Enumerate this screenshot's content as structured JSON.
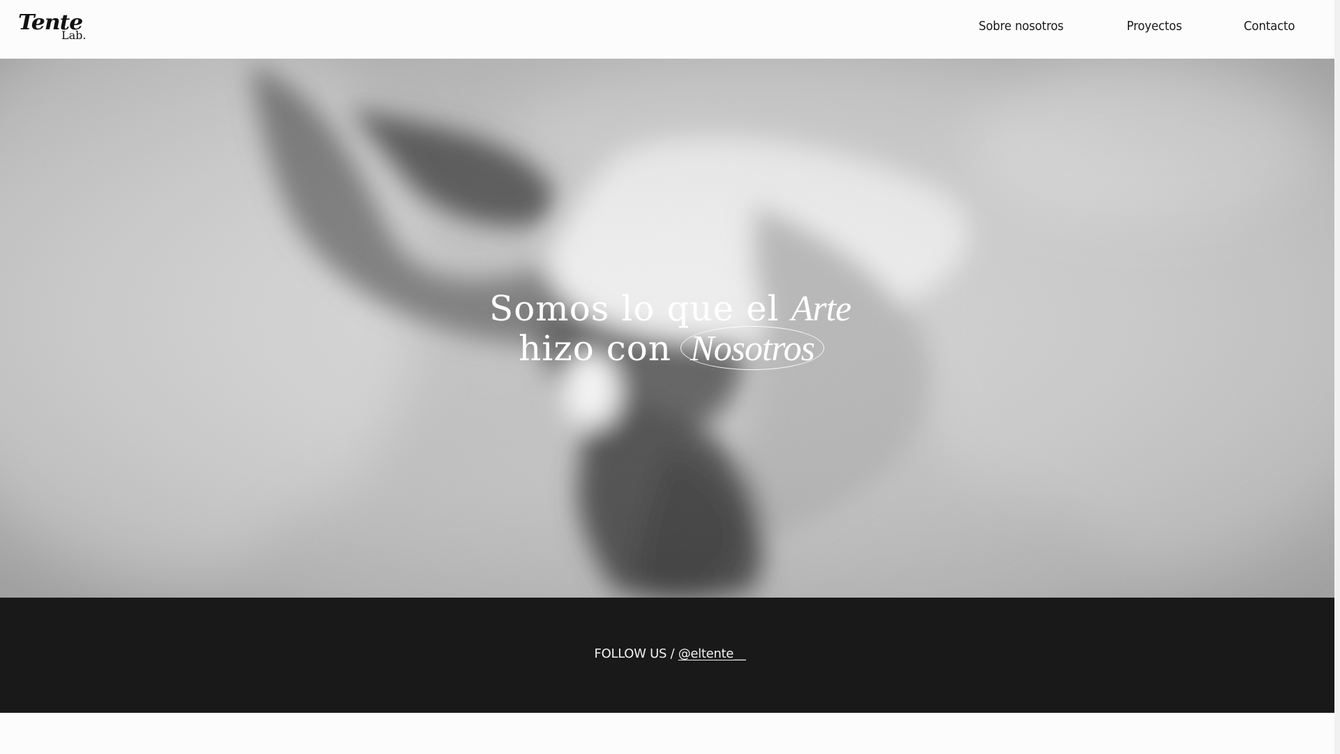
{
  "header": {
    "logo": {
      "main": "Tente",
      "sub": "Lab."
    },
    "nav": [
      {
        "label": "Sobre nosotros"
      },
      {
        "label": "Proyectos"
      },
      {
        "label": "Contacto"
      }
    ]
  },
  "hero": {
    "line1_prefix": "Somos lo que el ",
    "line1_em": "Arte",
    "line2_prefix": "hizo con ",
    "line2_em": "Nosotros"
  },
  "follow": {
    "prefix": "FOLLOW US / ",
    "handle": "@eltente__"
  },
  "colors": {
    "header_bg": "#fcfcfc",
    "band_bg": "#191919",
    "hero_text": "#ffffff"
  }
}
